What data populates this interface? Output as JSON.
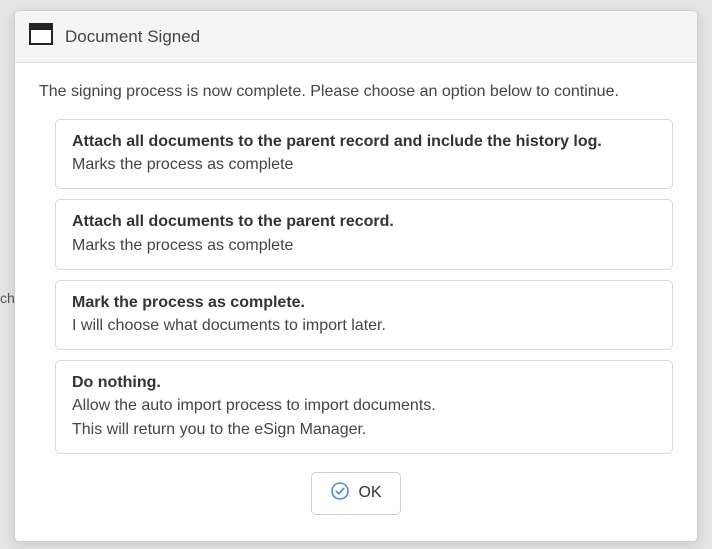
{
  "background_fragment": "ch",
  "dialog": {
    "title": "Document Signed",
    "intro": "The signing process is now complete. Please choose an option below to continue.",
    "options": [
      {
        "title": "Attach all documents to the parent record and include the history log.",
        "desc": "Marks the process as complete"
      },
      {
        "title": "Attach all documents to the parent record.",
        "desc": "Marks the process as complete"
      },
      {
        "title": "Mark the process as complete.",
        "desc": "I will choose what documents to import later."
      },
      {
        "title": "Do nothing.",
        "desc": "Allow the auto import process to import documents.\nThis will return you to the eSign Manager."
      }
    ],
    "ok_label": "OK"
  }
}
